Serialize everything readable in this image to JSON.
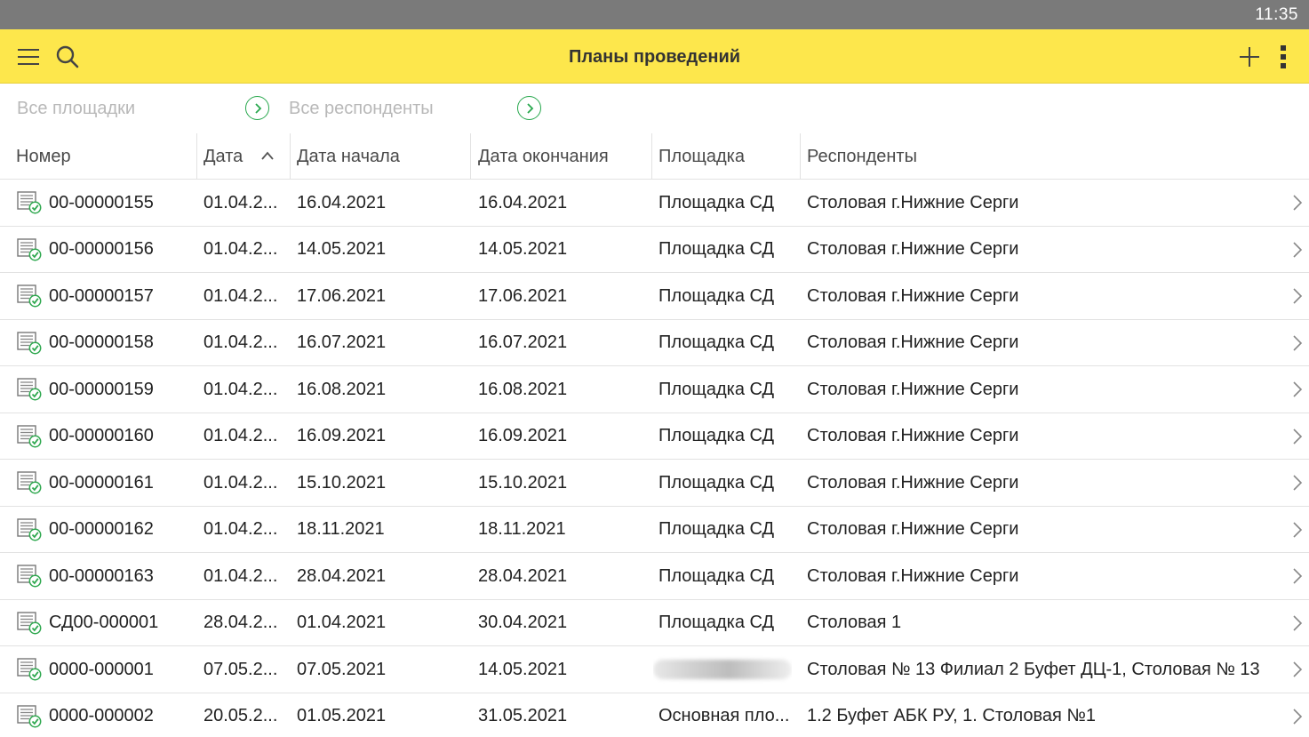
{
  "status": {
    "time": "11:35"
  },
  "appbar": {
    "title": "Планы проведений"
  },
  "filters": {
    "venue_placeholder": "Все площадки",
    "respondents_placeholder": "Все респонденты"
  },
  "columns": {
    "number": "Номер",
    "date": "Дата",
    "start_date": "Дата начала",
    "end_date": "Дата окончания",
    "venue": "Площадка",
    "respondents": "Респонденты"
  },
  "sort": {
    "column": "date",
    "direction": "ascending"
  },
  "rows": [
    {
      "number": "00-00000155",
      "date": "01.04.2...",
      "start": "16.04.2021",
      "end": "16.04.2021",
      "venue": "Площадка СД",
      "respondents": "Столовая г.Нижние Серги"
    },
    {
      "number": "00-00000156",
      "date": "01.04.2...",
      "start": "14.05.2021",
      "end": "14.05.2021",
      "venue": "Площадка СД",
      "respondents": "Столовая г.Нижние Серги"
    },
    {
      "number": "00-00000157",
      "date": "01.04.2...",
      "start": "17.06.2021",
      "end": "17.06.2021",
      "venue": "Площадка СД",
      "respondents": "Столовая г.Нижние Серги"
    },
    {
      "number": "00-00000158",
      "date": "01.04.2...",
      "start": "16.07.2021",
      "end": "16.07.2021",
      "venue": "Площадка СД",
      "respondents": "Столовая г.Нижние Серги"
    },
    {
      "number": "00-00000159",
      "date": "01.04.2...",
      "start": "16.08.2021",
      "end": "16.08.2021",
      "venue": "Площадка СД",
      "respondents": "Столовая г.Нижние Серги"
    },
    {
      "number": "00-00000160",
      "date": "01.04.2...",
      "start": "16.09.2021",
      "end": "16.09.2021",
      "venue": "Площадка СД",
      "respondents": "Столовая г.Нижние Серги"
    },
    {
      "number": "00-00000161",
      "date": "01.04.2...",
      "start": "15.10.2021",
      "end": "15.10.2021",
      "venue": "Площадка СД",
      "respondents": "Столовая г.Нижние Серги"
    },
    {
      "number": "00-00000162",
      "date": "01.04.2...",
      "start": "18.11.2021",
      "end": "18.11.2021",
      "venue": "Площадка СД",
      "respondents": "Столовая г.Нижние Серги"
    },
    {
      "number": "00-00000163",
      "date": "01.04.2...",
      "start": "28.04.2021",
      "end": "28.04.2021",
      "venue": "Площадка СД",
      "respondents": "Столовая г.Нижние Серги"
    },
    {
      "number": "СД00-000001",
      "date": "28.04.2...",
      "start": "01.04.2021",
      "end": "30.04.2021",
      "venue": "Площадка СД",
      "respondents": "Столовая 1"
    },
    {
      "number": "0000-000001",
      "date": "07.05.2...",
      "start": "07.05.2021",
      "end": "14.05.2021",
      "venue": "",
      "venue_redacted": true,
      "respondents": "Столовая № 13 Филиал 2 Буфет  ДЦ-1, Столовая № 13"
    },
    {
      "number": "0000-000002",
      "date": "20.05.2...",
      "start": "01.05.2021",
      "end": "31.05.2021",
      "venue": "Основная пло...",
      "respondents": "1.2 Буфет АБК РУ, 1. Столовая №1"
    }
  ],
  "colors": {
    "appbar": "#fde74c",
    "statusbar": "#7a7a7a",
    "accent_green": "#29a84e"
  }
}
